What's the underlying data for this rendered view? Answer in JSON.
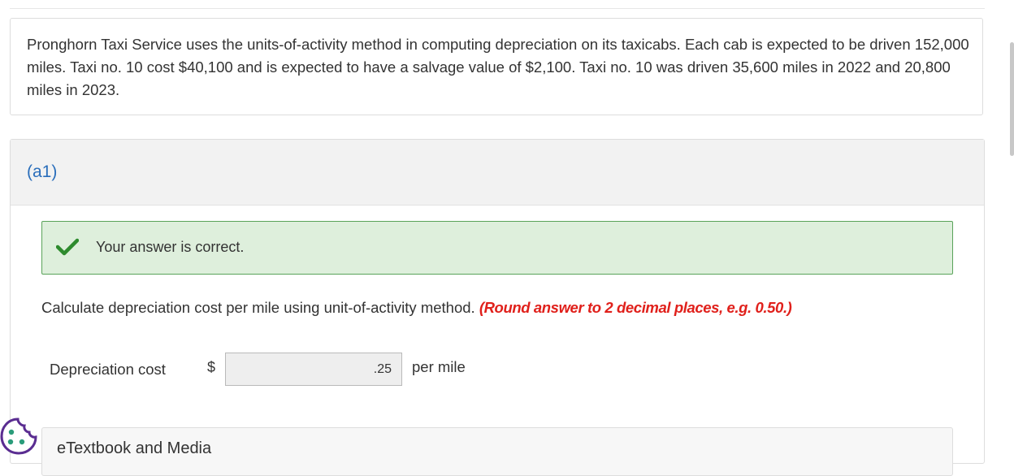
{
  "problem": {
    "text": "Pronghorn Taxi Service uses the units-of-activity method in computing depreciation on its taxicabs. Each cab is expected to be driven 152,000 miles. Taxi no. 10 cost $40,100 and is expected to have a salvage value of $2,100. Taxi no. 10 was driven 35,600 miles in 2022 and 20,800 miles in 2023."
  },
  "part": {
    "label": "(a1)",
    "feedback": "Your answer is correct.",
    "question": "Calculate depreciation cost per mile using unit-of-activity method.",
    "hint": "(Round answer to 2 decimal places, e.g. 0.50.)",
    "row_label": "Depreciation cost",
    "currency": "$",
    "answer_value": ".25",
    "unit": "per mile",
    "etextbook_label": "eTextbook and Media"
  },
  "colors": {
    "part_label": "#2a6ebb",
    "feedback_bg": "#deefdc",
    "feedback_border": "#5aa35a",
    "check_green": "#2e8b2e",
    "hint_red": "#e0201b"
  },
  "icons": {
    "check": "check-icon",
    "cookie": "cookie-icon"
  }
}
